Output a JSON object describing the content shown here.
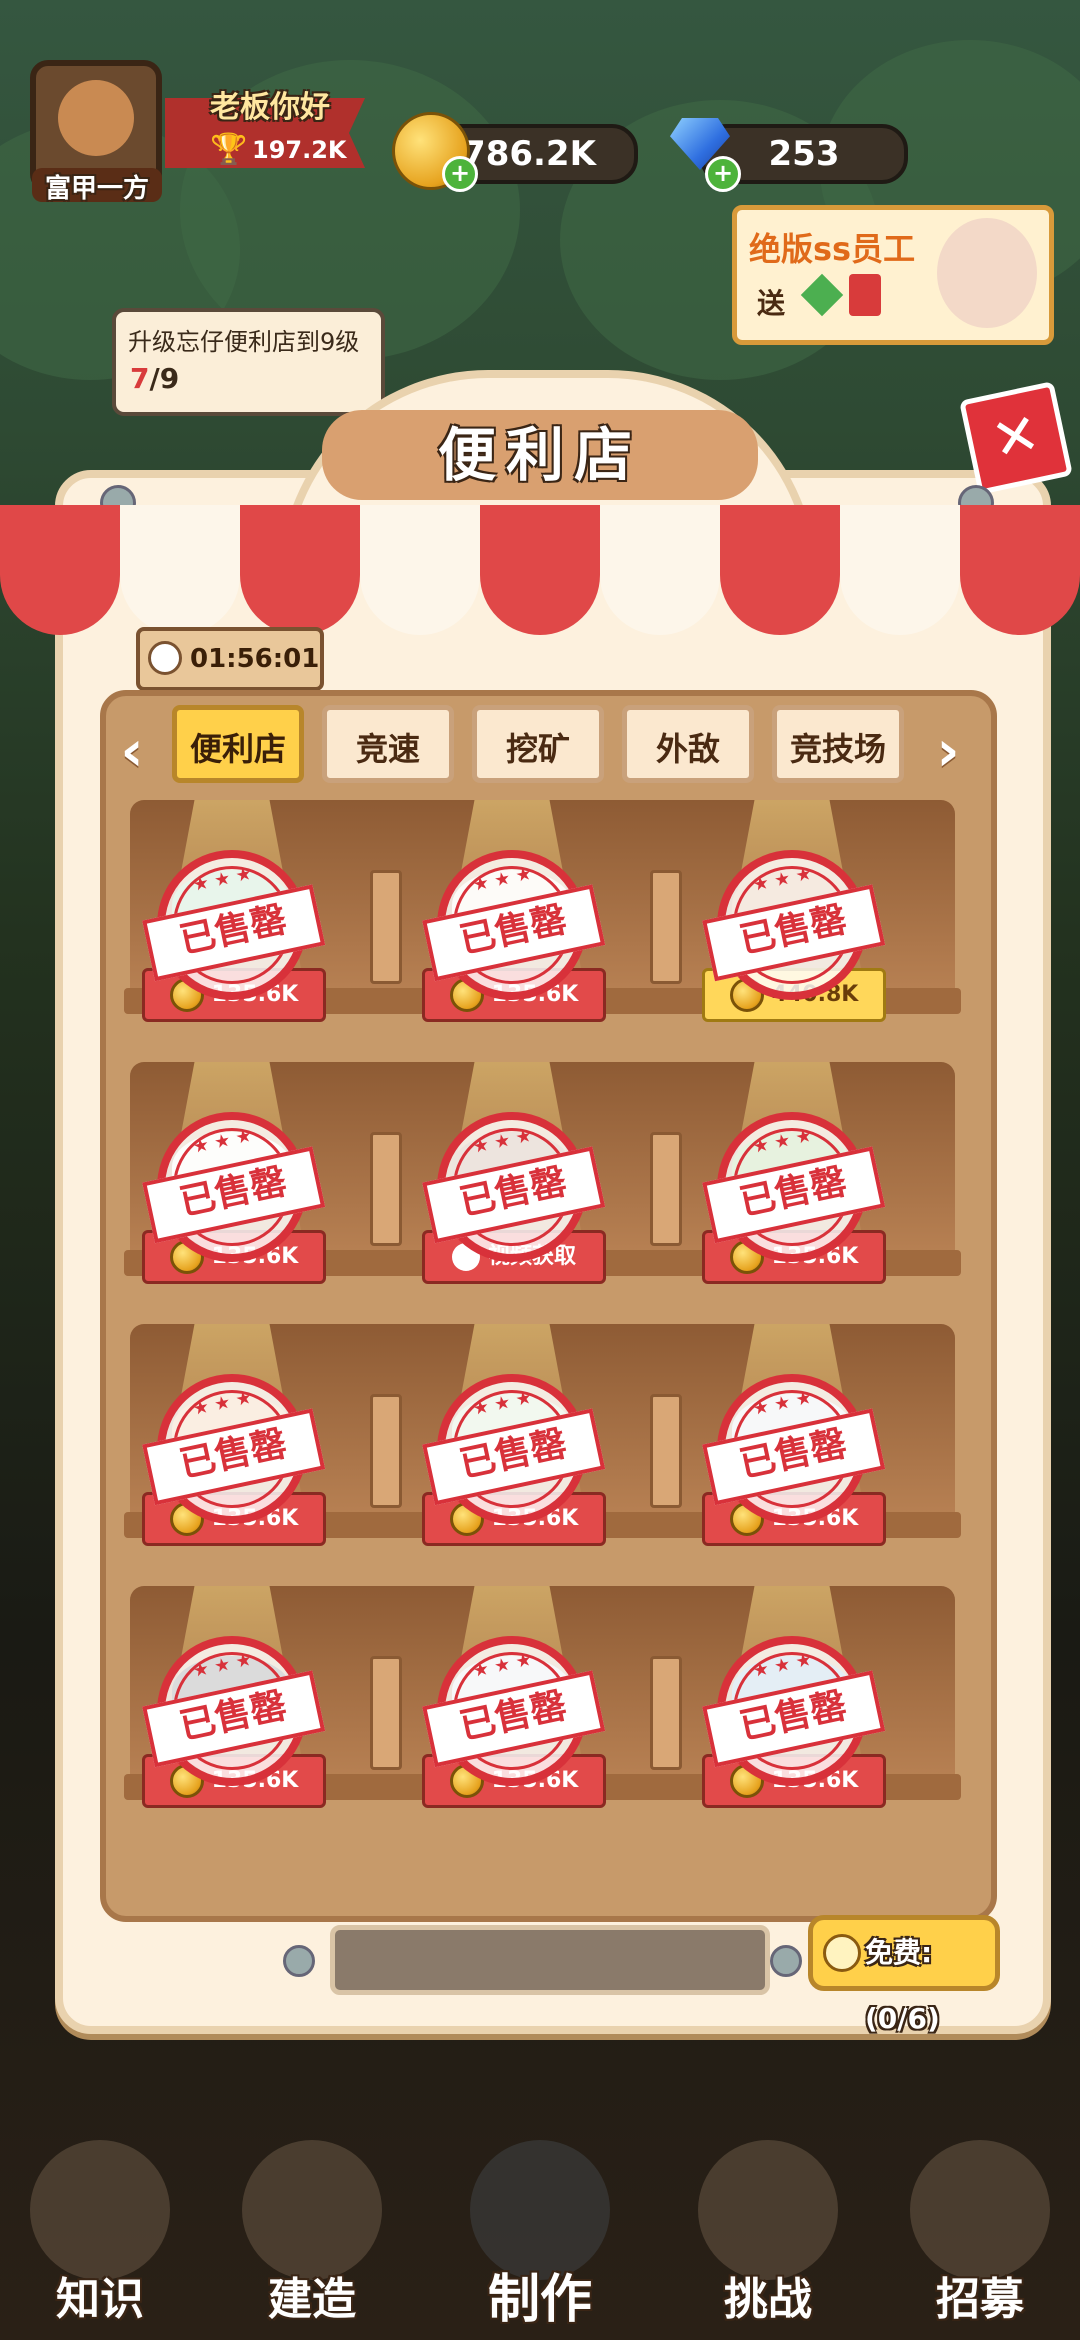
{
  "player": {
    "title_badge": "富甲一方",
    "greeting": "老板你好",
    "trophy_score": "197.2K"
  },
  "currency": {
    "gold": "786.2K",
    "gems": "253"
  },
  "promo": {
    "line1": "绝版ss员工",
    "line2": "送"
  },
  "quest": {
    "text": "升级忘仔便利店到9级",
    "progress_current": "7",
    "progress_total": "/9"
  },
  "panel": {
    "title": "便利店",
    "timer": "01:56:01",
    "close_label": "✕"
  },
  "tabs": [
    {
      "label": "便利店",
      "active": true
    },
    {
      "label": "竞速",
      "active": false
    },
    {
      "label": "挖矿",
      "active": false
    },
    {
      "label": "外敌",
      "active": false
    },
    {
      "label": "竞技场",
      "active": false
    }
  ],
  "sold_out_label": "已售罄",
  "shelves": [
    {
      "items": [
        {
          "price": "135.6K",
          "style": "red"
        },
        {
          "price": "135.6K",
          "style": "red"
        },
        {
          "price": "440.8K",
          "style": "gold"
        }
      ]
    },
    {
      "items": [
        {
          "price": "135.6K",
          "style": "red"
        },
        {
          "price": "视频获取",
          "style": "video"
        },
        {
          "price": "135.6K",
          "style": "red"
        }
      ]
    },
    {
      "items": [
        {
          "price": "135.6K",
          "style": "red"
        },
        {
          "price": "135.6K",
          "style": "red"
        },
        {
          "price": "135.6K",
          "style": "red"
        }
      ]
    },
    {
      "items": [
        {
          "price": "135.6K",
          "style": "red"
        },
        {
          "price": "135.6K",
          "style": "red"
        },
        {
          "price": "135.6K",
          "style": "red"
        }
      ]
    }
  ],
  "free_refresh": {
    "label": "免费:(0/6)"
  },
  "bottom_nav": [
    {
      "label": "知识"
    },
    {
      "label": "建造"
    },
    {
      "label": "制作"
    },
    {
      "label": "挑战"
    },
    {
      "label": "招募"
    }
  ],
  "colors": {
    "awning_red": "#e04848",
    "awning_white": "#fdf6ea",
    "tab_active": "#ffd04a",
    "stamp_red": "#d8313a",
    "price_red": "#e24a4a",
    "price_gold": "#ffd75a"
  }
}
